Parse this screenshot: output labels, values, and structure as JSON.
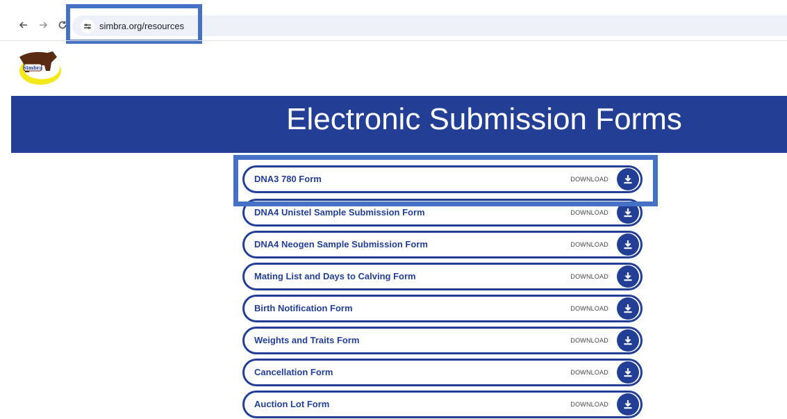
{
  "browser": {
    "url": "simbra.org/resources",
    "back_icon": "arrow-left-icon",
    "forward_icon": "arrow-right-icon",
    "reload_icon": "reload-icon",
    "site_info_icon": "tune-icon"
  },
  "logo": {
    "text": "Simbra"
  },
  "page": {
    "title": "Electronic Submission Forms"
  },
  "forms": [
    {
      "name": "DNA3 780 Form",
      "action": "DOWNLOAD"
    },
    {
      "name": "DNA4 Unistel Sample Submission Form",
      "action": "DOWNLOAD"
    },
    {
      "name": "DNA4 Neogen Sample Submission Form",
      "action": "DOWNLOAD"
    },
    {
      "name": "Mating List and Days to Calving Form",
      "action": "DOWNLOAD"
    },
    {
      "name": "Birth Notification Form",
      "action": "DOWNLOAD"
    },
    {
      "name": "Weights and Traits Form",
      "action": "DOWNLOAD"
    },
    {
      "name": "Cancellation Form",
      "action": "DOWNLOAD"
    },
    {
      "name": "Auction Lot Form",
      "action": "DOWNLOAD"
    }
  ],
  "colors": {
    "brand": "#233f95",
    "highlight": "#4471c4"
  }
}
